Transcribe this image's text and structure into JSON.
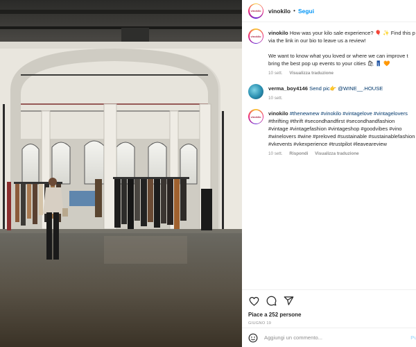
{
  "photo": {
    "description_icon": "store-interior-photo"
  },
  "header": {
    "avatar_text": "vinokilo",
    "username": "vinokilo",
    "dot": "•",
    "follow_label": "Segui"
  },
  "comments": [
    {
      "username": "vinokilo",
      "lines": [
        "How was your kilo sale experience? 🎈 ✨ Find this p",
        "via the link in our bio to leave us a review!"
      ],
      "lines2": [
        "We want to know what you loved or where we can improve t",
        "bring the best pop up events to your cities 🛍 👖 🧡"
      ],
      "time": "10 sett.",
      "action": "Visualizza traduzione"
    },
    {
      "username": "verma_boy4146",
      "text": "Send pic👉 @WINE__.HOUSE",
      "time": "10 sett."
    },
    {
      "username": "vinokilo",
      "lines": [
        "#thenewnew #vinokilo #vintagelove #vintagelovers",
        "#thrifting #thrift #secondhandfirst #secondhandfashion",
        "#vintage #vintagefashion #vintageshop #goodvibes #vino",
        "#winelovers #wine #preloved #sustainable #sustainablefashion",
        "#vkevents #vkexperience #trustpilot #leaveareview"
      ],
      "time": "10 sett.",
      "reply": "Rispondi",
      "action": "Visualizza traduzione"
    }
  ],
  "actions": {
    "like_icon": "heart-icon",
    "comment_icon": "comment-bubble-icon",
    "share_icon": "paper-plane-icon"
  },
  "likes": "Piace a 252 persone",
  "date": "GIUGNO 19",
  "add_comment": {
    "placeholder": "Aggiungi un commento...",
    "publish": "Pu"
  },
  "colors": {
    "link_blue": "#0095f6",
    "hashtag": "#00376b",
    "meta_gray": "#8e8e8e",
    "text": "#262626"
  }
}
